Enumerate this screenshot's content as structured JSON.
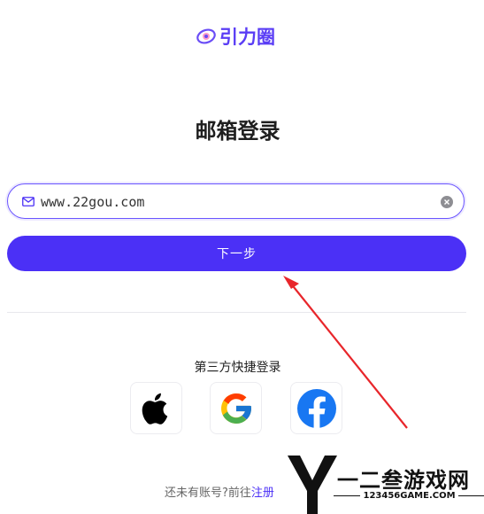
{
  "brand": {
    "name": "引力圈",
    "color": "#5a3df5"
  },
  "title": "邮箱登录",
  "email": {
    "value": "www.22gou.com",
    "icon": "mail-icon",
    "clear_icon": "clear-icon"
  },
  "next_button": {
    "label": "下一步",
    "color": "#4b30f6"
  },
  "third_party": {
    "title": "第三方快捷登录",
    "providers": [
      {
        "name": "apple",
        "icon": "apple-icon"
      },
      {
        "name": "google",
        "icon": "google-icon"
      },
      {
        "name": "facebook",
        "icon": "facebook-icon"
      }
    ]
  },
  "footer": {
    "prompt": "还未有账号?前往",
    "register_label": "注册"
  },
  "annotation": {
    "arrow_color": "#e8262b"
  },
  "watermark": {
    "logo_letter": "Y",
    "text": "一二叁游戏网",
    "sub": "123456GAME.COM"
  }
}
